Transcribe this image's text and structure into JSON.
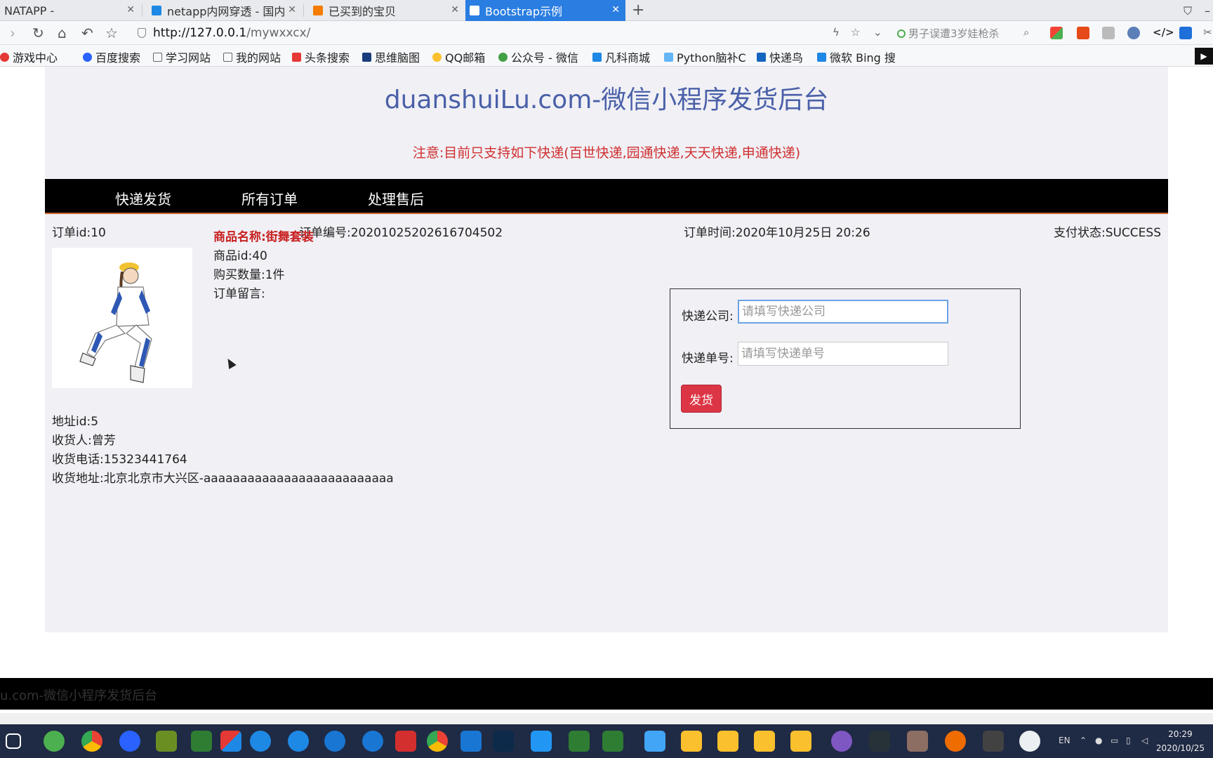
{
  "browser": {
    "tabs": [
      {
        "title": "NATAPP -",
        "active": false
      },
      {
        "title": "netapp内网穿透 - 国内",
        "active": false
      },
      {
        "title": "已买到的宝贝",
        "active": false
      },
      {
        "title": "Bootstrap示例",
        "active": true
      }
    ],
    "new_tab": "+",
    "url_host": "http://127.0.0.1",
    "url_path": "/mywxxcx/",
    "search_hint": "男子误遭3岁娃枪杀",
    "bookmarks": [
      "游戏中心",
      "百度搜索",
      "学习网站",
      "我的网站",
      "头条搜索",
      "思维脑图",
      "QQ邮箱",
      "公众号 - 微信",
      "凡科商城",
      "Python脑补C",
      "快递鸟",
      "微软 Bing 搜"
    ]
  },
  "page": {
    "title": "duanshuiLu.com-微信小程序发货后台",
    "notice": "注意:目前只支持如下快递(百世快递,园通快递,天天快递,申通快递)",
    "nav": [
      "快递发货",
      "所有订单",
      "处理售后"
    ],
    "order": {
      "id": "订单id:10",
      "number": "订单编号:20201025202616704502",
      "time": "订单时间:2020年10月25日 20:26",
      "pay_status": "支付状态:SUCCESS"
    },
    "product": {
      "name": "商品名称:街舞套装",
      "id": "商品id:40",
      "quantity": "购买数量:1件",
      "note": "订单留言:"
    },
    "address": {
      "id": "地址id:5",
      "receiver": "收货人:曾芳",
      "phone": "收货电话:15323441764",
      "addr": "收货地址:北京北京市大兴区-aaaaaaaaaaaaaaaaaaaaaaaaaa"
    },
    "shipping_form": {
      "company_label": "快递公司:",
      "company_placeholder": "请填写快递公司",
      "number_label": "快递单号:",
      "number_placeholder": "请填写快递单号",
      "submit": "发货"
    },
    "footer": "u.com-微信小程序发货后台"
  },
  "taskbar": {
    "lang": "EN",
    "time": "20:29",
    "date": "2020/10/25"
  }
}
